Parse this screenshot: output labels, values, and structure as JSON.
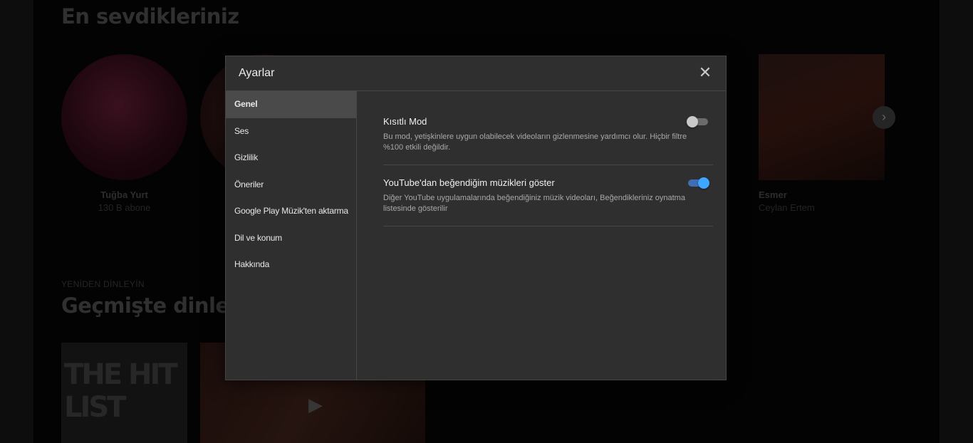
{
  "background": {
    "favorites_title": "En sevdikleriniz",
    "artists": [
      {
        "name": "Tuğba Yurt",
        "subtitle": "130 B abone"
      },
      {
        "name": "Esmer",
        "subtitle": "Ceylan Ertem"
      }
    ],
    "listen_again_overline": "YENİDEN DİNLEYİN",
    "history_title": "Geçmişte dinledi",
    "hitlist_text": "THE HIT LIST"
  },
  "dialog": {
    "title": "Ayarlar",
    "close_icon": "close-icon",
    "nav": [
      {
        "label": "Genel",
        "active": true
      },
      {
        "label": "Ses"
      },
      {
        "label": "Gizlilik"
      },
      {
        "label": "Öneriler"
      },
      {
        "label": "Google Play Müzik'ten aktarma"
      },
      {
        "label": "Dil ve konum"
      },
      {
        "label": "Hakkında"
      }
    ],
    "settings": [
      {
        "title": "Kısıtlı Mod",
        "description": "Bu mod, yetişkinlere uygun olabilecek videoların gizlenmesine yardımcı olur. Hiçbir filtre %100 etkili değildir.",
        "enabled": false
      },
      {
        "title": "YouTube'dan beğendiğim müzikleri göster",
        "description": "Diğer YouTube uygulamalarında beğendiğiniz müzik videoları, Beğendikleriniz oynatma listesinde gösterilir",
        "enabled": true
      }
    ]
  },
  "colors": {
    "accent": "#3ea6ff",
    "dialog_bg": "#2f2f2f"
  }
}
